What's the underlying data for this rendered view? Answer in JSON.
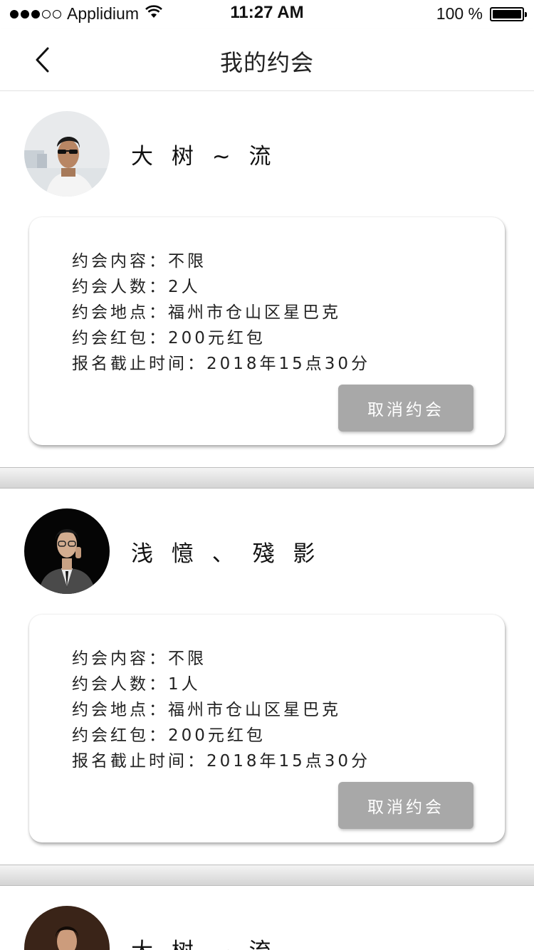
{
  "status_bar": {
    "carrier": "Applidium",
    "time": "11:27 AM",
    "battery": "100 %"
  },
  "nav": {
    "title": "我的约会"
  },
  "dates": [
    {
      "name": "大 树 ~ 流",
      "content": "约会内容：不限",
      "count": "约会人数：2人",
      "location": "约会地点：福州市仓山区星巴克",
      "red_packet": "约会红包：200元红包",
      "deadline": "报名截止时间：2018年15点30分",
      "cancel_label": "取消约会"
    },
    {
      "name": "浅 憶 、 殘 影",
      "content": "约会内容：不限",
      "count": "约会人数：1人",
      "location": "约会地点：福州市仓山区星巴克",
      "red_packet": "约会红包：200元红包",
      "deadline": "报名截止时间：2018年15点30分",
      "cancel_label": "取消约会"
    },
    {
      "name": "大 树 ~ 流"
    }
  ],
  "icons": {
    "back": "chevron-left-icon",
    "wifi": "wifi-icon",
    "battery": "battery-icon"
  }
}
